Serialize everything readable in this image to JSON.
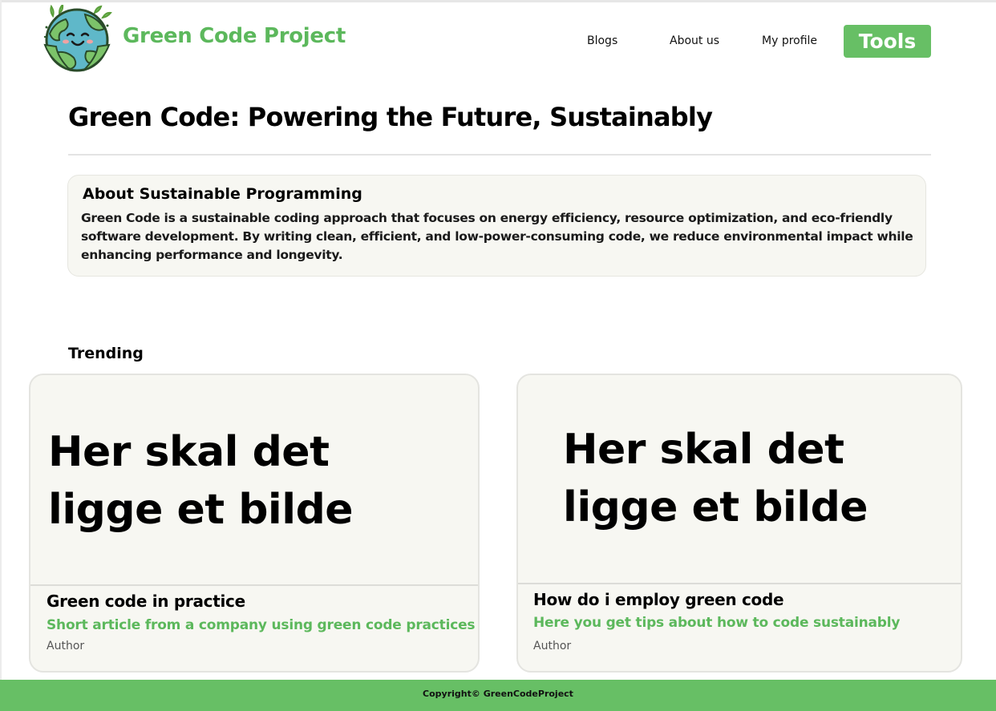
{
  "header": {
    "brand": "Green Code Project",
    "nav": {
      "blogs": "Blogs",
      "about": "About us",
      "profile": "My profile",
      "tools": "Tools"
    },
    "logo_icon": "smiling-earth-icon"
  },
  "main": {
    "title": "Green Code: Powering the Future, Sustainably",
    "about": {
      "heading": "About Sustainable Programming",
      "text": "Green Code is a sustainable coding approach that focuses on energy efficiency, resource optimization, and eco-friendly software development. By writing clean, efficient, and low-power-consuming code, we reduce environmental impact while enhancing performance and longevity."
    },
    "trending": {
      "label": "Trending",
      "cards": [
        {
          "image_text": "Her skal det ligge et bilde",
          "title": "Green code in practice",
          "description": "Short article from a company using green code practices",
          "author": "Author"
        },
        {
          "image_text": "Her skal det ligge et bilde",
          "title": "How do i employ green code",
          "description": "Here you get tips about how to code sustainably",
          "author": "Author"
        }
      ]
    }
  },
  "footer": {
    "copyright": "Copyright© GreenCodeProject"
  },
  "colors": {
    "brand_green": "#5cb85c",
    "button_green": "#67bf65",
    "card_bg": "#f7f7f2"
  }
}
